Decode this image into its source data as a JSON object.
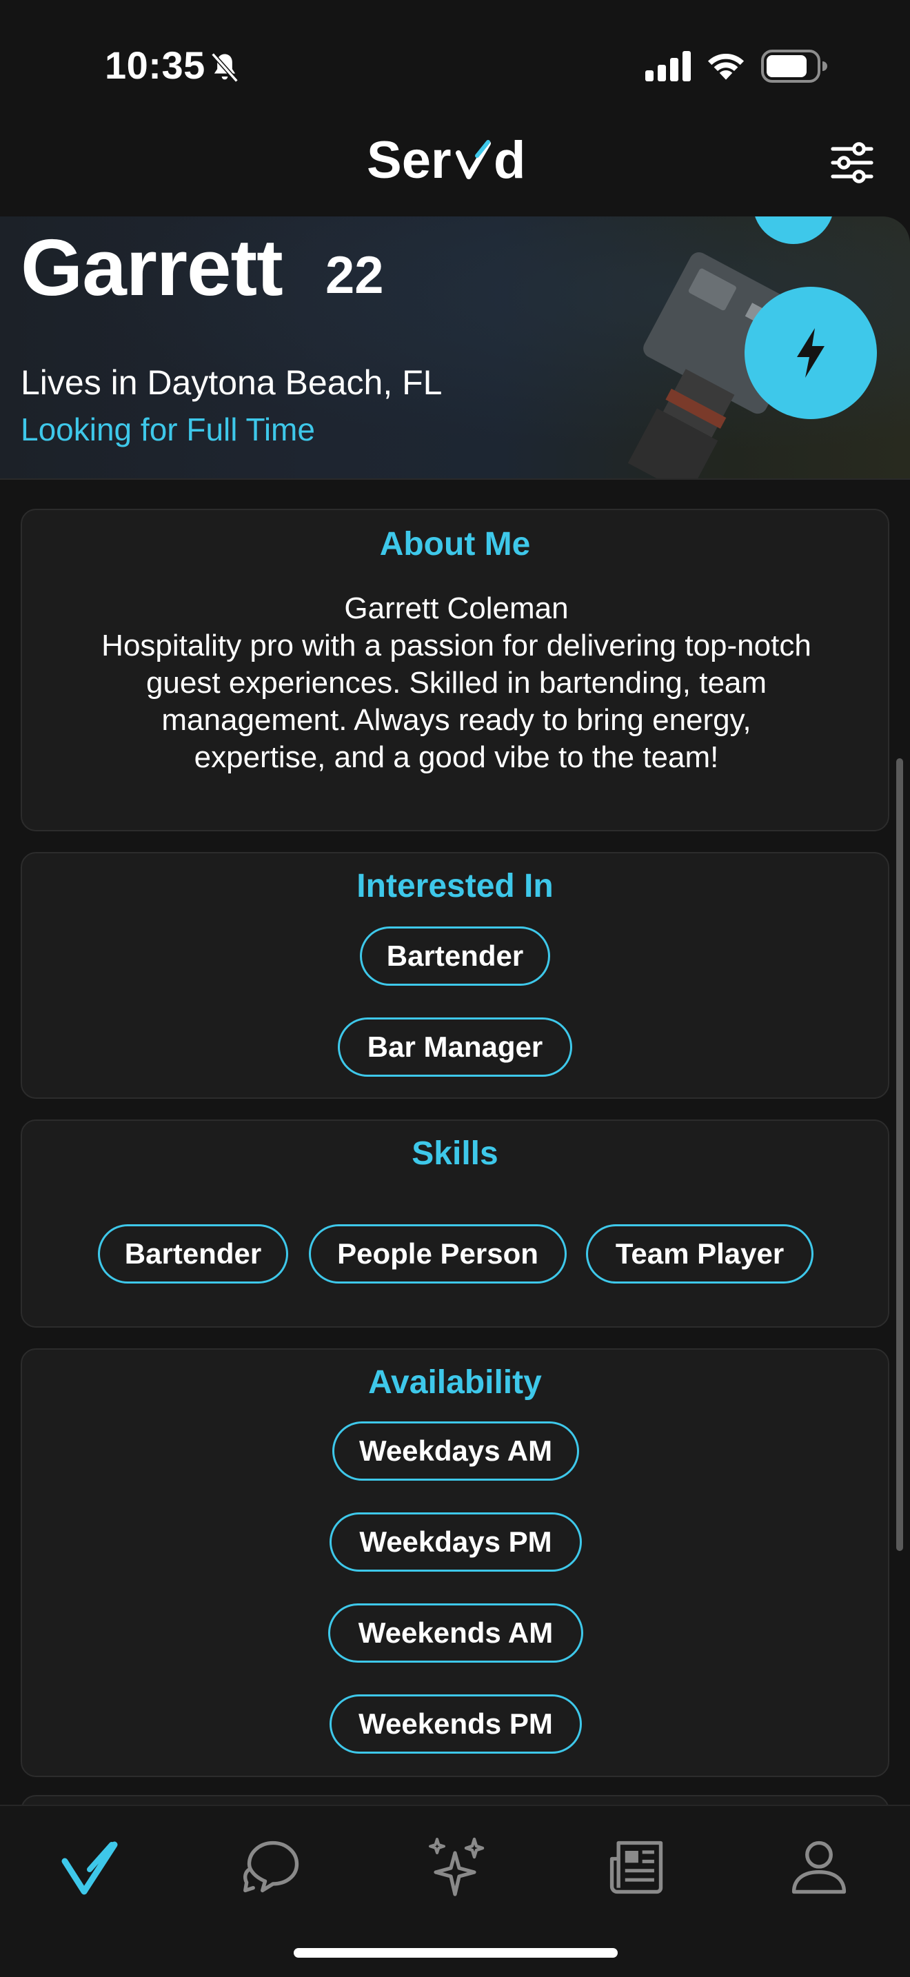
{
  "status_bar": {
    "time": "10:35"
  },
  "header": {
    "logo_text": "Serv/d"
  },
  "profile": {
    "name": "Garrett",
    "age": "22",
    "location": "Lives in Daytona Beach, FL",
    "looking_for": "Looking for Full Time"
  },
  "about": {
    "title": "About Me",
    "text": "Garrett Coleman\nHospitality pro with a passion for delivering top-notch guest experiences. Skilled in bartending, team management. Always ready to bring energy, expertise, and a good vibe to the team!"
  },
  "interested": {
    "title": "Interested In",
    "items": [
      "Bartender",
      "Bar Manager"
    ]
  },
  "skills": {
    "title": "Skills",
    "items": [
      "Bartender",
      "People Person",
      "Team Player"
    ]
  },
  "availability": {
    "title": "Availability",
    "items": [
      "Weekdays AM",
      "Weekdays PM",
      "Weekends AM",
      "Weekends PM"
    ]
  },
  "tabs": [
    {
      "icon": "checkmark-logo-icon",
      "active": true
    },
    {
      "icon": "chat-bubbles-icon",
      "active": false
    },
    {
      "icon": "sparkles-icon",
      "active": false
    },
    {
      "icon": "newspaper-icon",
      "active": false
    },
    {
      "icon": "person-icon",
      "active": false
    }
  ],
  "colors": {
    "accent": "#3ec8ea",
    "background": "#141414",
    "card": "#1c1c1c",
    "tab_inactive": "#8a8a8a"
  }
}
